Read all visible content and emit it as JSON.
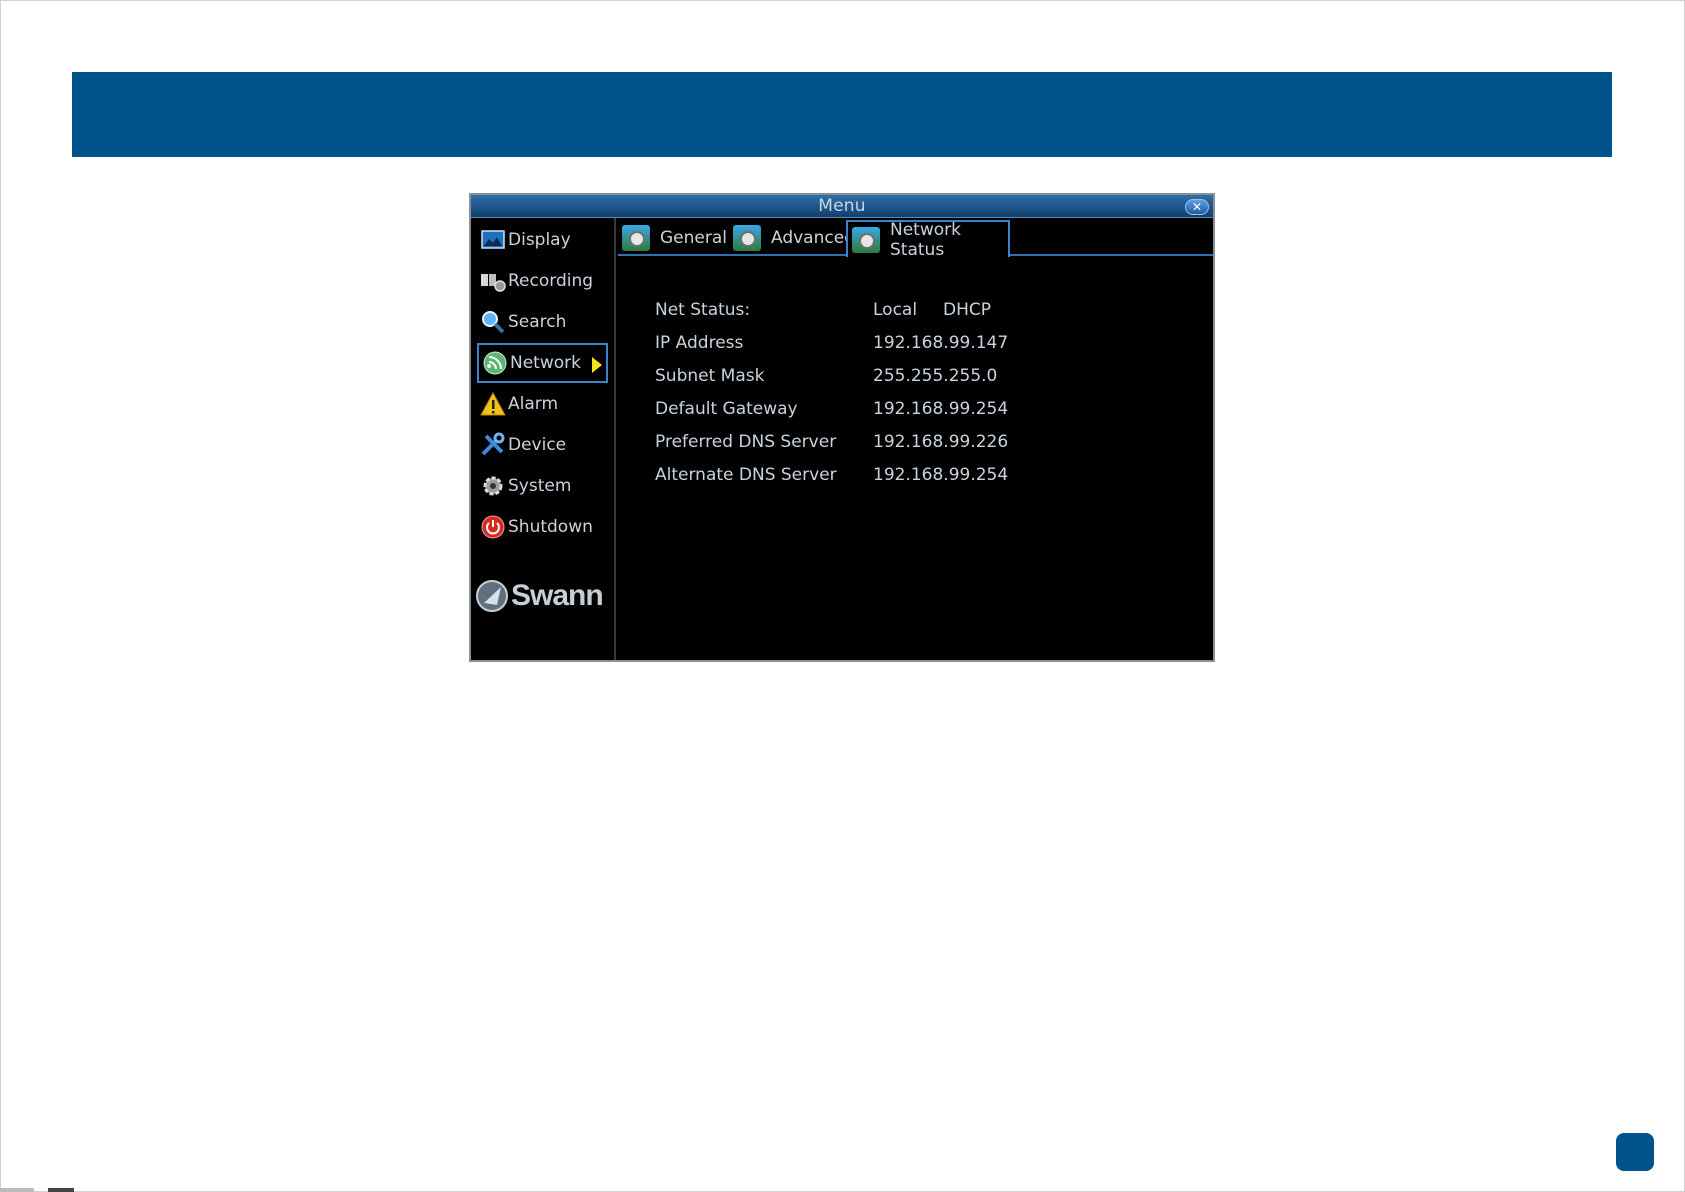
{
  "window": {
    "title": "Menu",
    "close_symbol": "✕"
  },
  "sidebar": {
    "items": [
      {
        "label": "Display",
        "icon": "display-icon"
      },
      {
        "label": "Recording",
        "icon": "recording-icon"
      },
      {
        "label": "Search",
        "icon": "search-icon"
      },
      {
        "label": "Network",
        "icon": "network-icon",
        "active": true
      },
      {
        "label": "Alarm",
        "icon": "alarm-icon"
      },
      {
        "label": "Device",
        "icon": "device-icon"
      },
      {
        "label": "System",
        "icon": "system-icon"
      },
      {
        "label": "Shutdown",
        "icon": "shutdown-icon"
      }
    ],
    "logo": "Swann"
  },
  "tabs": [
    {
      "label": "General"
    },
    {
      "label": "Advanced"
    },
    {
      "label": "Network Status",
      "active": true
    }
  ],
  "network_status": {
    "net_status_label": "Net Status:",
    "net_status_value_1": "Local",
    "net_status_value_2": "DHCP",
    "rows": [
      {
        "label": "IP Address",
        "value": "192.168.99.147"
      },
      {
        "label": "Subnet Mask",
        "value": "255.255.255.0"
      },
      {
        "label": "Default Gateway",
        "value": "192.168.99.254"
      },
      {
        "label": "Preferred DNS Server",
        "value": "192.168.99.226"
      },
      {
        "label": "Alternate DNS Server",
        "value": "192.168.99.254"
      }
    ]
  },
  "colors": {
    "banner": "#00548c",
    "accent_border": "#3d82c9",
    "arrow": "#f4e21c"
  }
}
